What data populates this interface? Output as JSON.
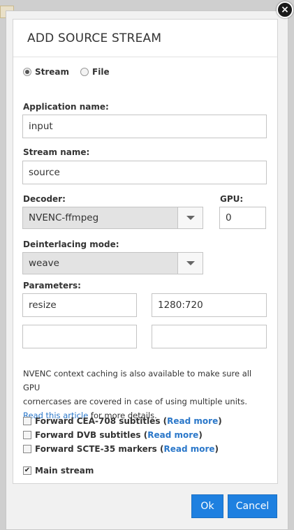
{
  "dialog": {
    "title": "ADD SOURCE STREAM",
    "close_symbol": "×"
  },
  "source_type": {
    "options": [
      {
        "label": "Stream",
        "selected": true
      },
      {
        "label": "File",
        "selected": false
      }
    ]
  },
  "fields": {
    "application_name": {
      "label": "Application name:",
      "value": "input"
    },
    "stream_name": {
      "label": "Stream name:",
      "value": "source"
    },
    "decoder": {
      "label": "Decoder:",
      "value": "NVENC-ffmpeg"
    },
    "gpu": {
      "label": "GPU:",
      "value": "0"
    },
    "deinterlacing": {
      "label": "Deinterlacing mode:",
      "value": "weave"
    },
    "parameters": {
      "label": "Parameters:",
      "rows": [
        {
          "key": "resize",
          "value": "1280:720"
        },
        {
          "key": "",
          "value": ""
        }
      ]
    }
  },
  "info": {
    "line1": "NVENC context caching is also available to make sure all GPU",
    "line2": "cornercases are covered in case of using multiple units.",
    "link_text": "Read this article",
    "line3_suffix": " for more details."
  },
  "checkboxes": [
    {
      "label": "Forward CEA-708 subtitles",
      "link": "Read more",
      "checked": false
    },
    {
      "label": "Forward DVB subtitles",
      "link": "Read more",
      "checked": false
    },
    {
      "label": "Forward SCTE-35 markers",
      "link": "Read more",
      "checked": false
    }
  ],
  "main_stream": {
    "label": "Main stream",
    "checked": true,
    "check_glyph": "✔"
  },
  "buttons": {
    "ok": "Ok",
    "cancel": "Cancel"
  },
  "colors": {
    "primary": "#1e80e0",
    "link": "#2a77c9"
  }
}
